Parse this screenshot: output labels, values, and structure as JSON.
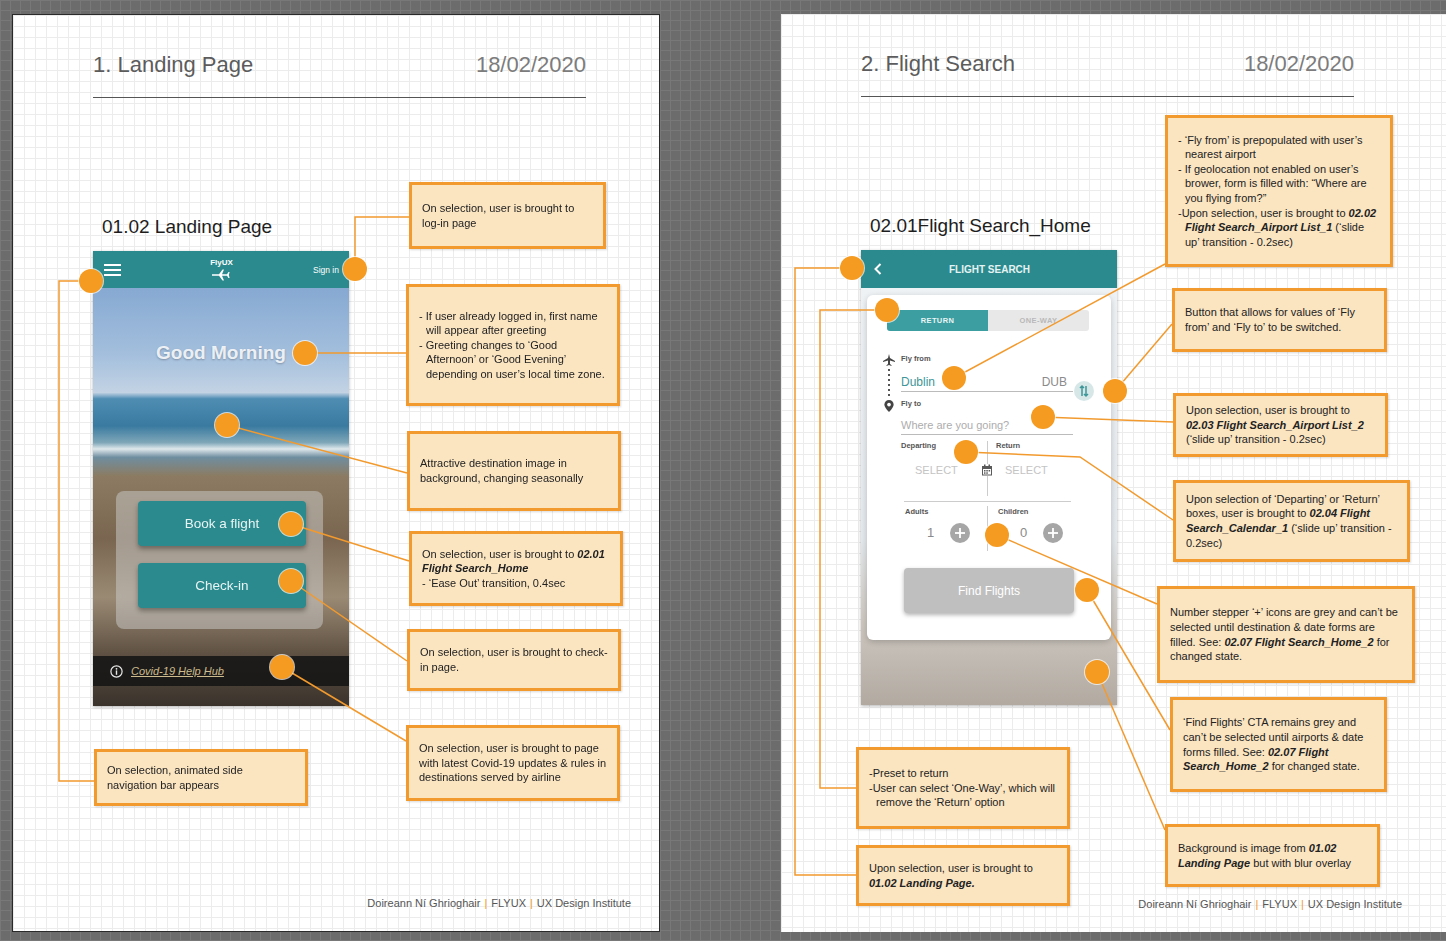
{
  "pages": [
    {
      "kind": "landing",
      "title": "1. Landing Page",
      "date": "18/02/2020",
      "screen_title": "01.02 Landing Page",
      "phone": {
        "logo": "FlyUX",
        "sign_in": "Sign in",
        "greeting": "Good Morning",
        "buttons": [
          "Book a flight",
          "Check-in"
        ],
        "help_link": "Covid-19 Help Hub"
      },
      "annotations": [
        {
          "lines": [
            [
              {
                "text": "On selection, user is brought to log-in page",
                "em": false
              }
            ]
          ]
        },
        {
          "lines": [
            [
              {
                "text": "- If user already logged in, first name will appear after greeting",
                "em": false
              }
            ],
            [
              {
                "text": "- Greeting changes to ‘Good Afternoon’ or ‘Good Evening’ depending on user’s local time zone.",
                "em": false
              }
            ]
          ]
        },
        {
          "lines": [
            [
              {
                "text": "Attractive destination image in background, changing seasonally",
                "em": false
              }
            ]
          ]
        },
        {
          "lines": [
            [
              {
                "text": "On selection, user is brought to ",
                "em": false
              },
              {
                "text": "02.01 Flight Search_Home",
                "em": true
              }
            ],
            [
              {
                "text": "- ‘Ease Out’ transition, 0.4sec",
                "em": false
              }
            ]
          ]
        },
        {
          "lines": [
            [
              {
                "text": "On selection, user is brought to check-in page.",
                "em": false
              }
            ]
          ]
        },
        {
          "lines": [
            [
              {
                "text": "On selection, user is brought to page with latest Covid-19 updates & rules in destinations served by airline",
                "em": false
              }
            ]
          ]
        },
        {
          "lines": [
            [
              {
                "text": "On selection, animated side navigation bar appears",
                "em": false
              }
            ]
          ]
        }
      ],
      "footer": {
        "author": "Doireann Ní Ghrioghair",
        "project": "FLYUX",
        "school": "UX Design Institute",
        "separator": "|"
      }
    },
    {
      "kind": "search",
      "title": "2. Flight Search",
      "date": "18/02/2020",
      "screen_title": "02.01Flight Search_Home",
      "phone": {
        "header": "FLIGHT SEARCH",
        "trip_types": [
          {
            "label": "RETURN",
            "selected": true
          },
          {
            "label": "ONE-WAY",
            "selected": false
          }
        ],
        "from": {
          "label": "Fly from",
          "value": "Dublin",
          "code": "DUB"
        },
        "to": {
          "label": "Fly to",
          "placeholder": "Where are you going?"
        },
        "dates": [
          {
            "label": "Departing",
            "value": "SELECT"
          },
          {
            "label": "Return",
            "value": "SELECT"
          }
        ],
        "passengers": [
          {
            "label": "Adults",
            "count": "1",
            "disabled": true
          },
          {
            "label": "Children",
            "count": "0",
            "disabled": true
          }
        ],
        "submit": {
          "label": "Find Flights",
          "disabled": true
        }
      },
      "annotations": [
        {
          "lines": [
            [
              {
                "text": "- ‘Fly from’ is prepopulated with user’s nearest airport",
                "em": false
              }
            ],
            [
              {
                "text": "- If geolocation not enabled on user’s brower, form is filled with: “Where are you flying from?”",
                "em": false
              }
            ],
            [
              {
                "text": "-Upon selection, user is brought to ",
                "em": false
              },
              {
                "text": "02.02 Flight Search_Airport List_1",
                "em": true
              },
              {
                "text": " (‘slide up’ transition - 0.2sec)",
                "em": false
              }
            ]
          ]
        },
        {
          "lines": [
            [
              {
                "text": "Button that allows for values of ‘Fly from’ and ‘Fly to’ to be switched.",
                "em": false
              }
            ]
          ]
        },
        {
          "lines": [
            [
              {
                "text": "Upon selection, user is brought to ",
                "em": false
              },
              {
                "text": "02.03 Flight Search_Airport List_2",
                "em": true
              },
              {
                "text": " (‘slide up’ transition - 0.2sec)",
                "em": false
              }
            ]
          ]
        },
        {
          "lines": [
            [
              {
                "text": "Upon selection of ‘Departing’ or ‘Return’ boxes, user is brought to ",
                "em": false
              },
              {
                "text": "02.04 Flight Search_Calendar_1",
                "em": true
              },
              {
                "text": " (‘slide up’ transition - 0.2sec)",
                "em": false
              }
            ]
          ]
        },
        {
          "lines": [
            [
              {
                "text": "Number stepper ‘+’ icons are grey and can’t be selected until destination & date forms are filled. See: ",
                "em": false
              },
              {
                "text": "02.07 Flight Search_Home_2",
                "em": true
              },
              {
                "text": " for changed state.",
                "em": false
              }
            ]
          ]
        },
        {
          "lines": [
            [
              {
                "text": "‘Find Flights’ CTA remains grey and can’t be selected until airports & date forms filled. See: ",
                "em": false
              },
              {
                "text": "02.07 Flight Search_Home_2",
                "em": true
              },
              {
                "text": " for changed state.",
                "em": false
              }
            ]
          ]
        },
        {
          "lines": [
            [
              {
                "text": "Background is image from ",
                "em": false
              },
              {
                "text": "01.02 Landing Page",
                "em": true
              },
              {
                "text": " but with blur overlay",
                "em": false
              }
            ]
          ]
        },
        {
          "lines": [
            [
              {
                "text": "-Preset to return",
                "em": false
              }
            ],
            [
              {
                "text": "-User can select ‘One-Way’, which will remove the ‘Return’ option",
                "em": false
              }
            ]
          ]
        },
        {
          "lines": [
            [
              {
                "text": "Upon selection, user is brought to ",
                "em": false
              },
              {
                "text": "01.02 Landing Page.",
                "em": true
              }
            ]
          ]
        }
      ],
      "footer": {
        "author": "Doireann Ní Ghrioghair",
        "project": "FLYUX",
        "school": "UX Design Institute",
        "separator": "|"
      }
    }
  ]
}
